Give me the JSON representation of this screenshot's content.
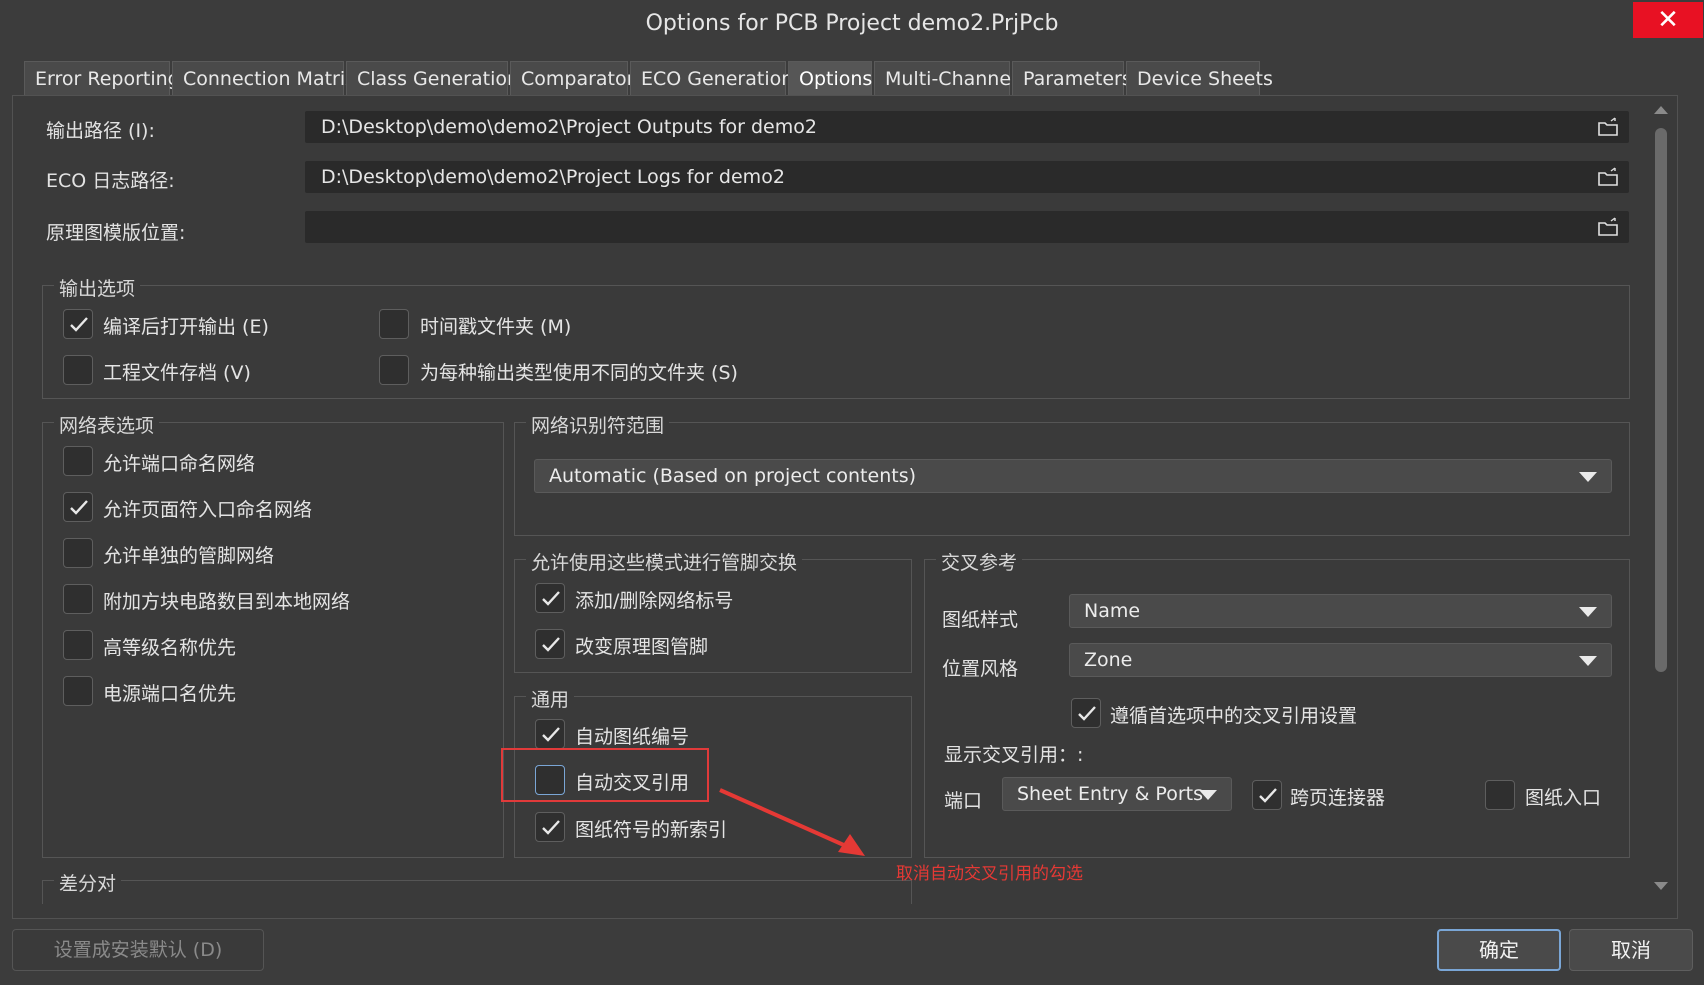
{
  "window": {
    "title": "Options for PCB Project demo2.PrjPcb",
    "close_glyph": "✕"
  },
  "tabs": [
    {
      "label": "Error Reporting"
    },
    {
      "label": "Connection Matrix"
    },
    {
      "label": "Class Generation"
    },
    {
      "label": "Comparator"
    },
    {
      "label": "ECO Generation"
    },
    {
      "label": "Options",
      "active": true
    },
    {
      "label": "Multi-Channel"
    },
    {
      "label": "Parameters"
    },
    {
      "label": "Device Sheets"
    }
  ],
  "paths": {
    "output_label": "输出路径 (I):",
    "output_value": "D:\\Desktop\\demo\\demo2\\Project Outputs for demo2",
    "eco_label": "ECO 日志路径:",
    "eco_value": "D:\\Desktop\\demo\\demo2\\Project Logs for demo2",
    "template_label": "原理图模版位置:",
    "template_value": ""
  },
  "output_options": {
    "title": "输出选项",
    "open_after_compile": {
      "label": "编译后打开输出 (E)",
      "checked": true
    },
    "timestamp_folder": {
      "label": "时间戳文件夹 (M)",
      "checked": false
    },
    "archive_project": {
      "label": "工程文件存档 (V)",
      "checked": false
    },
    "separate_folders": {
      "label": "为每种输出类型使用不同的文件夹 (S)",
      "checked": false
    }
  },
  "netlist_options": {
    "title": "网络表选项",
    "items": [
      {
        "label": "允许端口命名网络",
        "checked": false
      },
      {
        "label": "允许页面符入口命名网络",
        "checked": true
      },
      {
        "label": "允许单独的管脚网络",
        "checked": false
      },
      {
        "label": "附加方块电路数目到本地网络",
        "checked": false
      },
      {
        "label": "高等级名称优先",
        "checked": false
      },
      {
        "label": "电源端口名优先",
        "checked": false
      }
    ]
  },
  "net_identifier_scope": {
    "title": "网络识别符范围",
    "selected": "Automatic (Based on project contents)"
  },
  "pin_swap": {
    "title": "允许使用这些模式进行管脚交换",
    "items": [
      {
        "label": "添加/删除网络标号",
        "checked": true
      },
      {
        "label": "改变原理图管脚",
        "checked": true
      }
    ]
  },
  "general": {
    "title": "通用",
    "items": [
      {
        "label": "自动图纸编号",
        "checked": true
      },
      {
        "label": "自动交叉引用",
        "checked": false
      },
      {
        "label": "图纸符号的新索引",
        "checked": true
      }
    ]
  },
  "cross_ref": {
    "title": "交叉参考",
    "sheet_style_label": "图纸样式",
    "sheet_style_value": "Name",
    "location_style_label": "位置风格",
    "location_style_value": "Zone",
    "follow_prefs": {
      "label": "遵循首选项中的交叉引用设置",
      "checked": true
    },
    "display_label": "显示交叉引用：:",
    "port_label": "端口",
    "port_value": "Sheet Entry & Ports",
    "offsheet": {
      "label": "跨页连接器",
      "checked": true
    },
    "sheet_entry": {
      "label": "图纸入口",
      "checked": false
    }
  },
  "diff_pair": {
    "title": "差分对"
  },
  "annotation": {
    "text": "取消自动交叉引用的勾选",
    "color": "#e53935"
  },
  "footer": {
    "default_label": "设置成安装默认 (D)",
    "ok_label": "确定",
    "cancel_label": "取消"
  },
  "colors": {
    "accent": "#7aa6d6",
    "close": "#e81123",
    "annotation": "#e53935"
  }
}
